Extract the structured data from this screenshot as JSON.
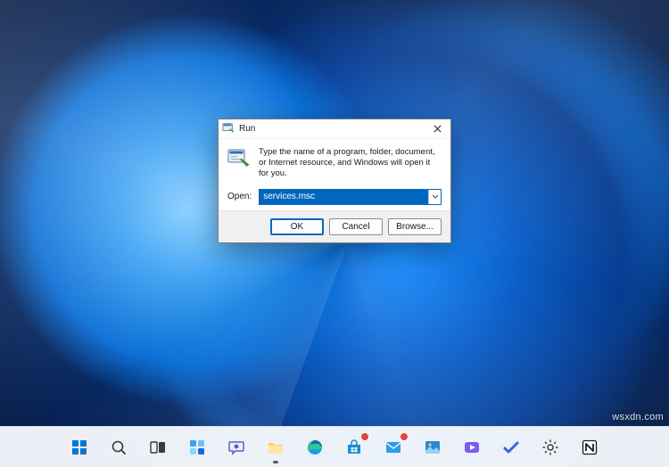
{
  "watermark": "wsxdn.com",
  "run_dialog": {
    "title": "Run",
    "description": "Type the name of a program, folder, document, or Internet resource, and Windows will open it for you.",
    "open_label": "Open:",
    "open_value": "services.msc",
    "buttons": {
      "ok": "OK",
      "cancel": "Cancel",
      "browse": "Browse..."
    }
  },
  "taskbar": {
    "icons": [
      "start-icon",
      "search-icon",
      "task-view-icon",
      "widgets-icon",
      "chat-icon",
      "file-explorer-icon",
      "edge-icon",
      "store-icon",
      "mail-icon",
      "photos-icon",
      "clipchamp-icon",
      "todo-icon",
      "settings-icon",
      "notion-icon"
    ]
  },
  "colors": {
    "accent": "#0067c0",
    "titlebar_bg": "#ffffff",
    "dialog_bg": "#ffffff",
    "footer_bg": "#f0f0f0",
    "taskbar_bg": "#f6f9fd"
  }
}
